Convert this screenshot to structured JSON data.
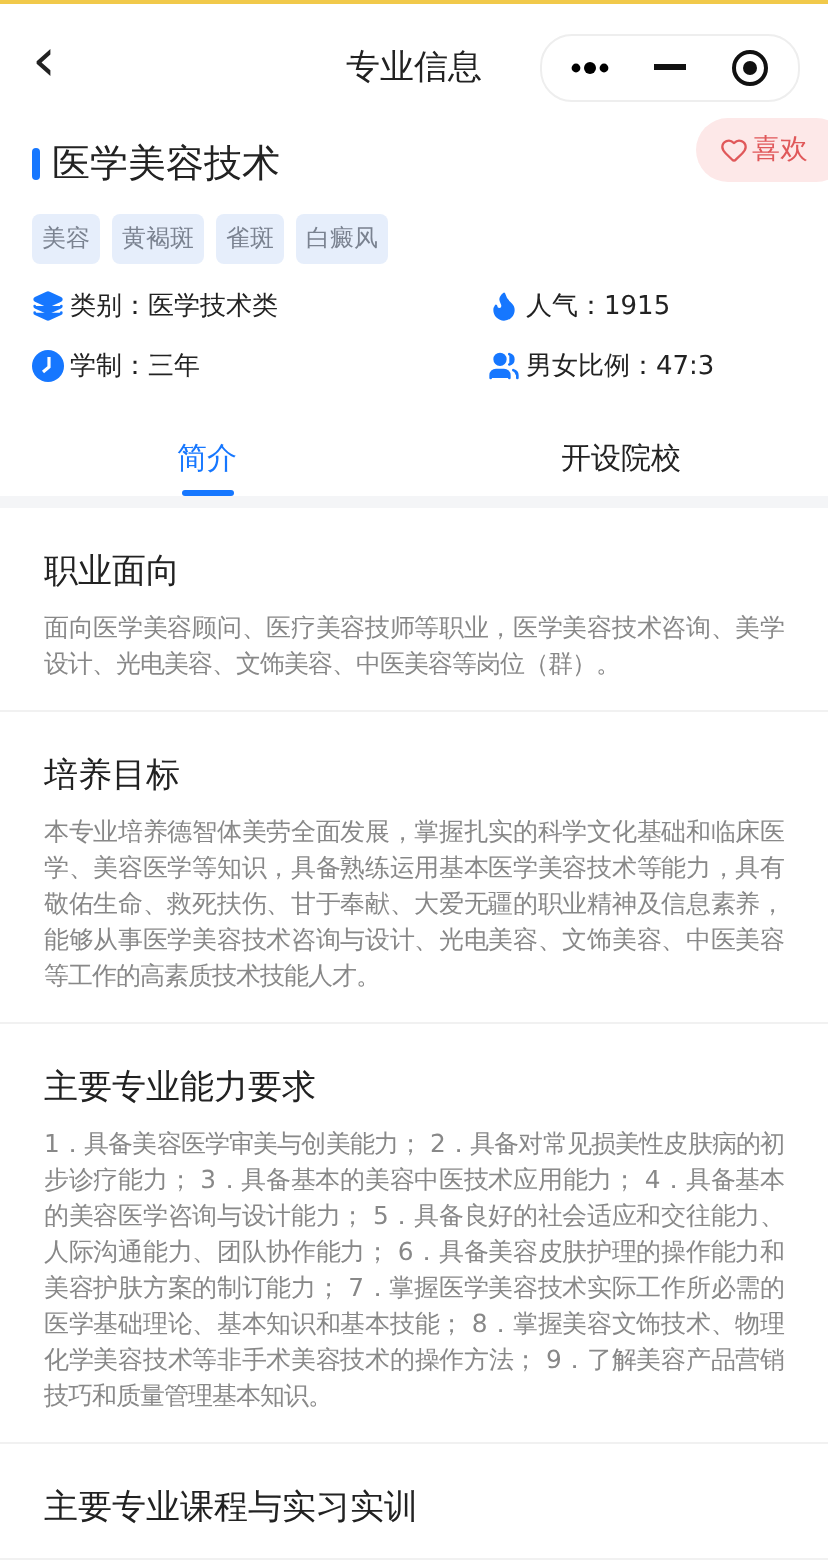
{
  "header": {
    "back": "‹",
    "title": "专业信息"
  },
  "major": {
    "name": "医学美容技术",
    "like": {
      "label": "喜欢",
      "selected": false
    },
    "tags": [
      "美容",
      "黄褐斑",
      "雀斑",
      "白癜风"
    ],
    "facts": [
      {
        "kind": "category",
        "text": "类别：医学技术类"
      },
      {
        "kind": "popularity",
        "text": "人气：1915"
      },
      {
        "kind": "duration",
        "text": "学制：三年"
      },
      {
        "kind": "ratio",
        "text": "男女比例：47:3"
      }
    ]
  },
  "tabs": [
    {
      "label": "简介",
      "selected": true
    },
    {
      "label": "开设院校",
      "selected": false
    }
  ],
  "sections": [
    {
      "title": "职业面向",
      "body": "面向医学美容顾问、医疗美容技师等职业，医学美容技术咨询、美学设计、光电美容、文饰美容、中医美容等岗位（群）。"
    },
    {
      "title": "培养目标",
      "body": "本专业培养德智体美劳全面发展，掌握扎实的科学文化基础和临床医学、美容医学等知识，具备熟练运用基本医学美容技术等能力，具有敬佑生命、救死扶伤、甘于奉献、大爱无疆的职业精神及信息素养，能够从事医学美容技术咨询与设计、光电美容、文饰美容、中医美容等工作的高素质技术技能人才。"
    },
    {
      "title": "主要专业能力要求",
      "body": "1．具备美容医学审美与创美能力； 2．具备对常见损美性皮肤病的初步诊疗能力； 3．具备基本的美容中医技术应用能力； 4．具备基本的美容医学咨询与设计能力； 5．具备良好的社会适应和交往能力、人际沟通能力、团队协作能力； 6．具备美容皮肤护理的操作能力和美容护肤方案的制订能力； 7．掌握医学美容技术实际工作所必需的医学基础理论、基本知识和基本技能； 8．掌握美容文饰技术、物理化学美容技术等非手术美容技术的操作方法； 9．了解美容产品营销技巧和质量管理基本知识。"
    },
    {
      "title": "主要专业课程与实习实训"
    }
  ]
}
